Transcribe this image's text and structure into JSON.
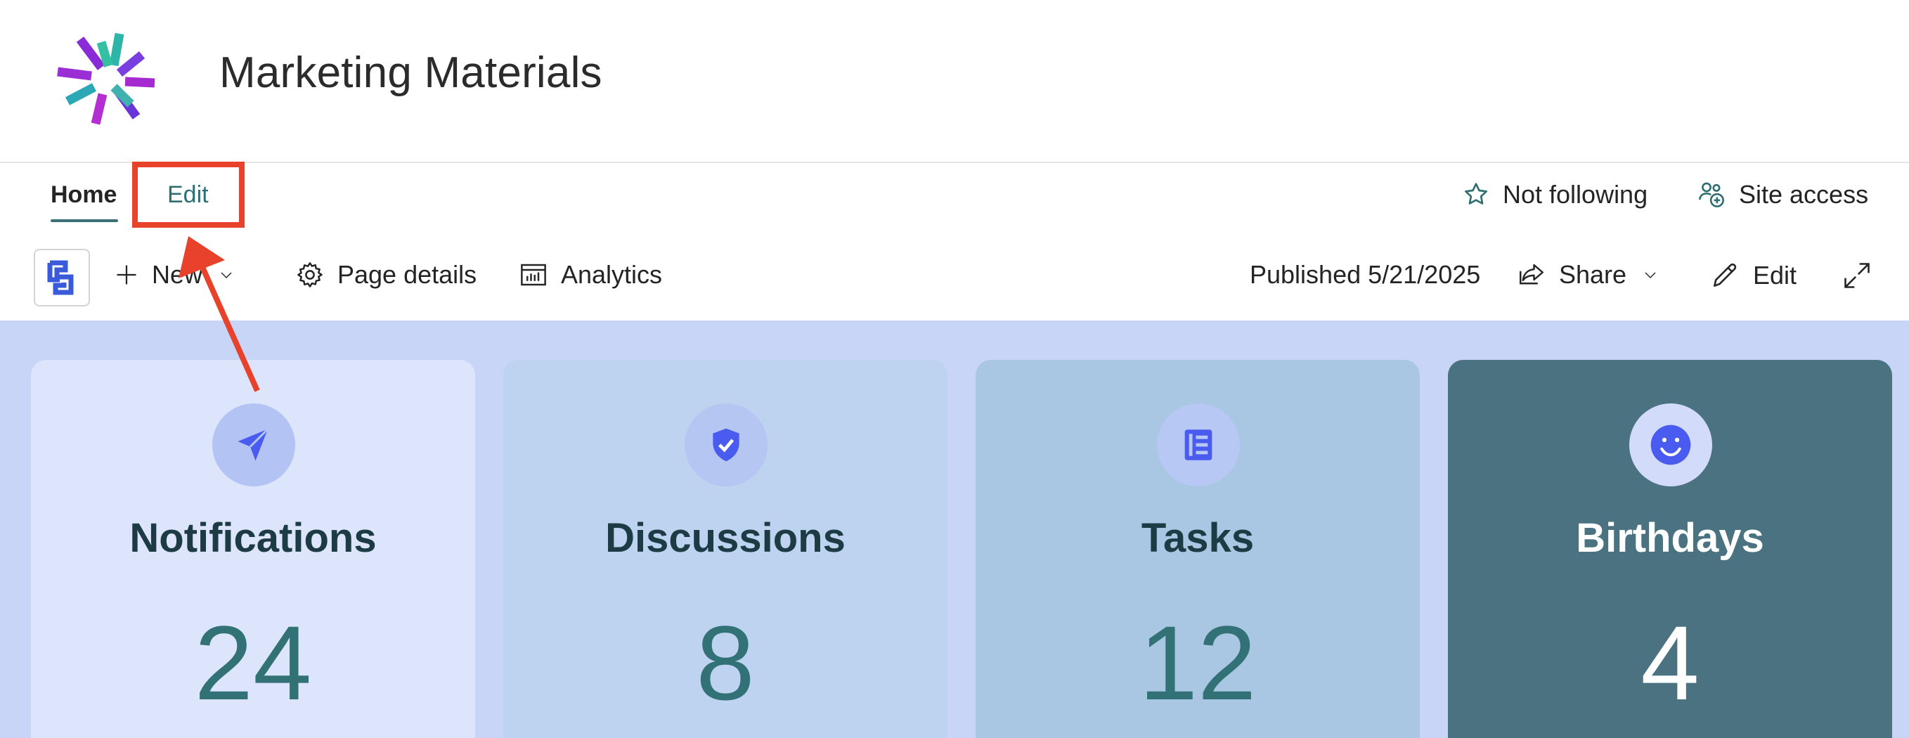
{
  "site": {
    "title": "Marketing Materials",
    "logo_icon": "starburst-logo"
  },
  "nav": {
    "tabs": [
      {
        "label": "Home",
        "active": true
      },
      {
        "label": "Edit",
        "active": false
      }
    ],
    "follow_label": "Not following",
    "site_access_label": "Site access"
  },
  "commandbar": {
    "new_label": "New",
    "page_details_label": "Page details",
    "analytics_label": "Analytics",
    "published_label": "Published 5/21/2025",
    "share_label": "Share",
    "edit_label": "Edit"
  },
  "cards": [
    {
      "title": "Notifications",
      "count": "24",
      "icon": "send-icon"
    },
    {
      "title": "Discussions",
      "count": "8",
      "icon": "shield-check-icon"
    },
    {
      "title": "Tasks",
      "count": "12",
      "icon": "notebook-icon"
    },
    {
      "title": "Birthdays",
      "count": "4",
      "icon": "smiley-icon"
    }
  ],
  "colors": {
    "accent": "#2f6e73",
    "annotation": "#e8412c",
    "hero_background": "#c8d5f7",
    "icon_blue": "#4a5cf0"
  }
}
